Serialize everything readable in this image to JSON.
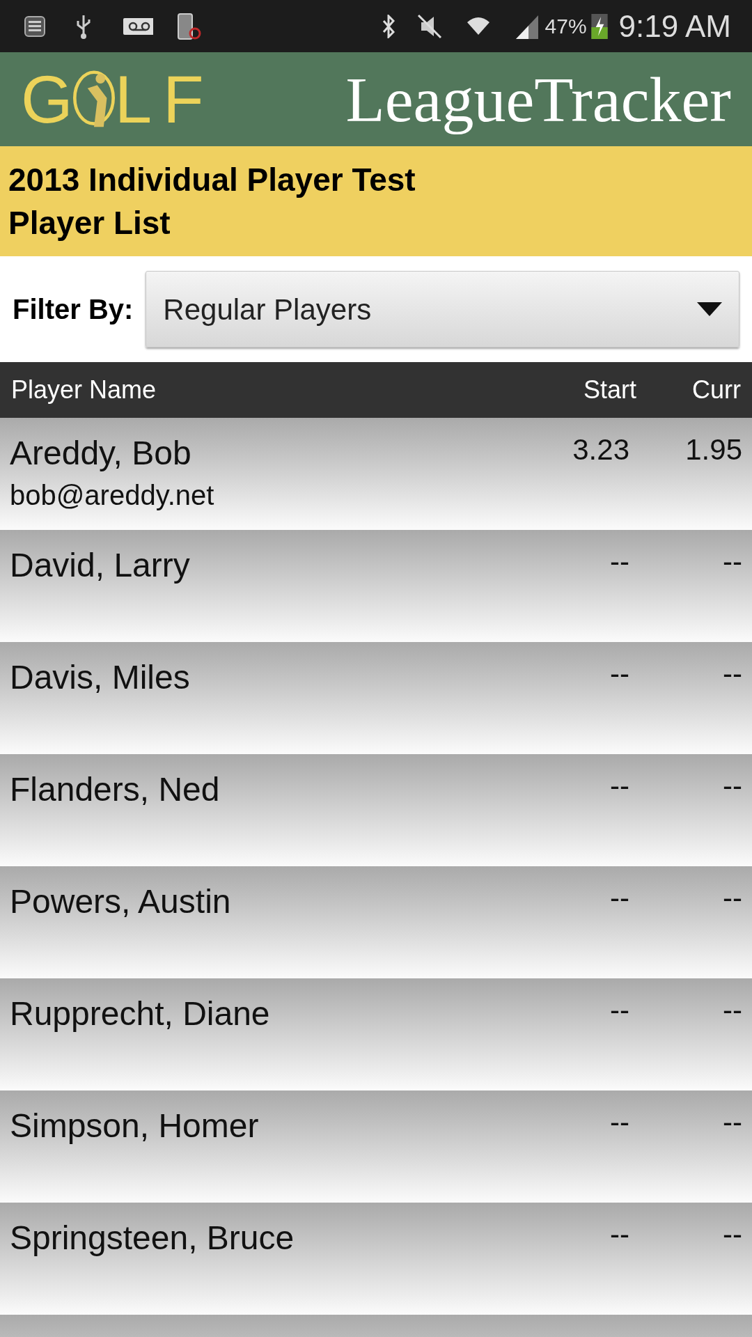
{
  "status_bar": {
    "battery": "47%",
    "time": "9:19 AM"
  },
  "logo": {
    "left": "G",
    "right": "LF",
    "title": "LeagueTracker"
  },
  "header": {
    "title": "2013 Individual Player Test",
    "subtitle": "Player List"
  },
  "filter": {
    "label": "Filter By:",
    "value": "Regular Players"
  },
  "table": {
    "columns": [
      "Player Name",
      "Start",
      "Curr"
    ],
    "rows": [
      {
        "name": "Areddy, Bob",
        "email": "bob@areddy.net",
        "start": "3.23",
        "curr": "1.95"
      },
      {
        "name": "David, Larry",
        "start": "--",
        "curr": "--"
      },
      {
        "name": "Davis, Miles",
        "start": "--",
        "curr": "--"
      },
      {
        "name": "Flanders, Ned",
        "start": "--",
        "curr": "--"
      },
      {
        "name": "Powers, Austin",
        "start": "--",
        "curr": "--"
      },
      {
        "name": "Rupprecht, Diane",
        "start": "--",
        "curr": "--"
      },
      {
        "name": "Simpson, Homer",
        "start": "--",
        "curr": "--"
      },
      {
        "name": "Springsteen, Bruce",
        "start": "--",
        "curr": "--"
      }
    ]
  }
}
